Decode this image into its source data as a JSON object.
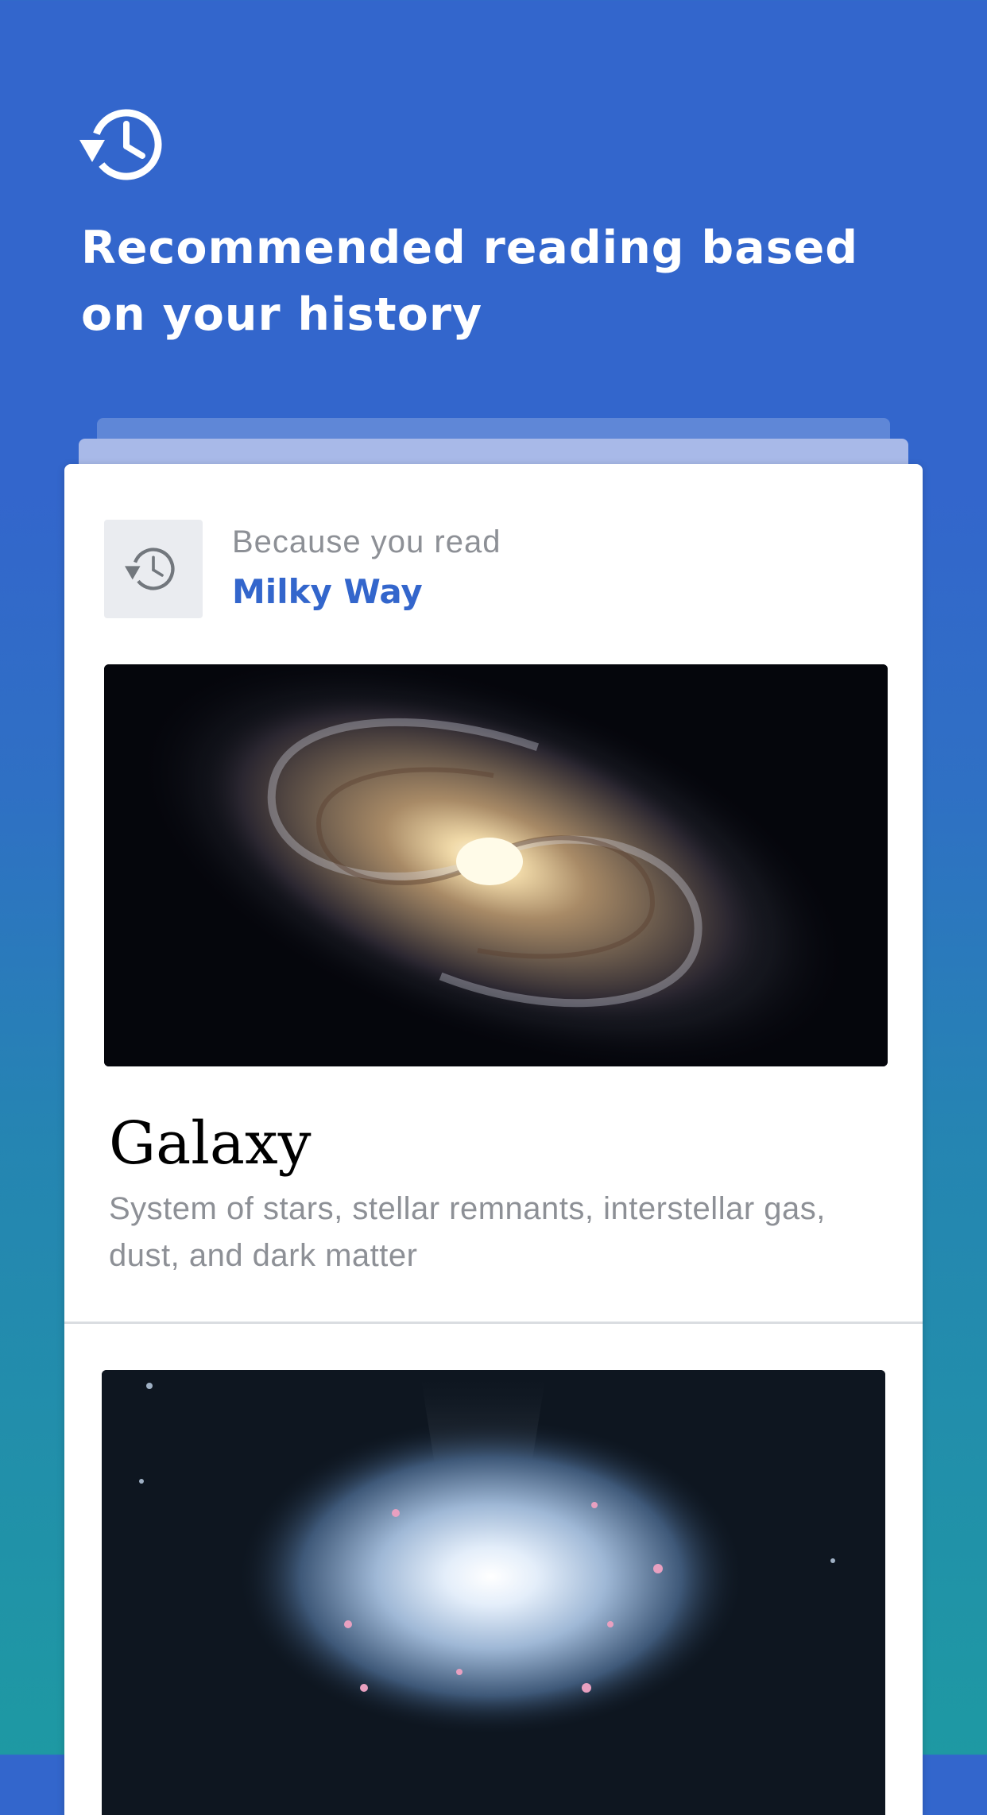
{
  "hero": {
    "icon": "history-icon",
    "title": "Recommended reading based on your history"
  },
  "card": {
    "thumb_icon": "history-icon",
    "because_label": "Because you read",
    "source_title": "Milky Way",
    "articles": [
      {
        "image": "spiral-galaxy-photo",
        "title": "Galaxy",
        "description": "System of stars, stellar remnants, interstellar gas, dust, and dark matter"
      },
      {
        "image": "galaxy-formation-illustration"
      }
    ]
  },
  "colors": {
    "background_top": "#3366cc",
    "background_bottom": "#1e99a3",
    "accent": "#3366cc",
    "muted_text": "#8d9096"
  }
}
